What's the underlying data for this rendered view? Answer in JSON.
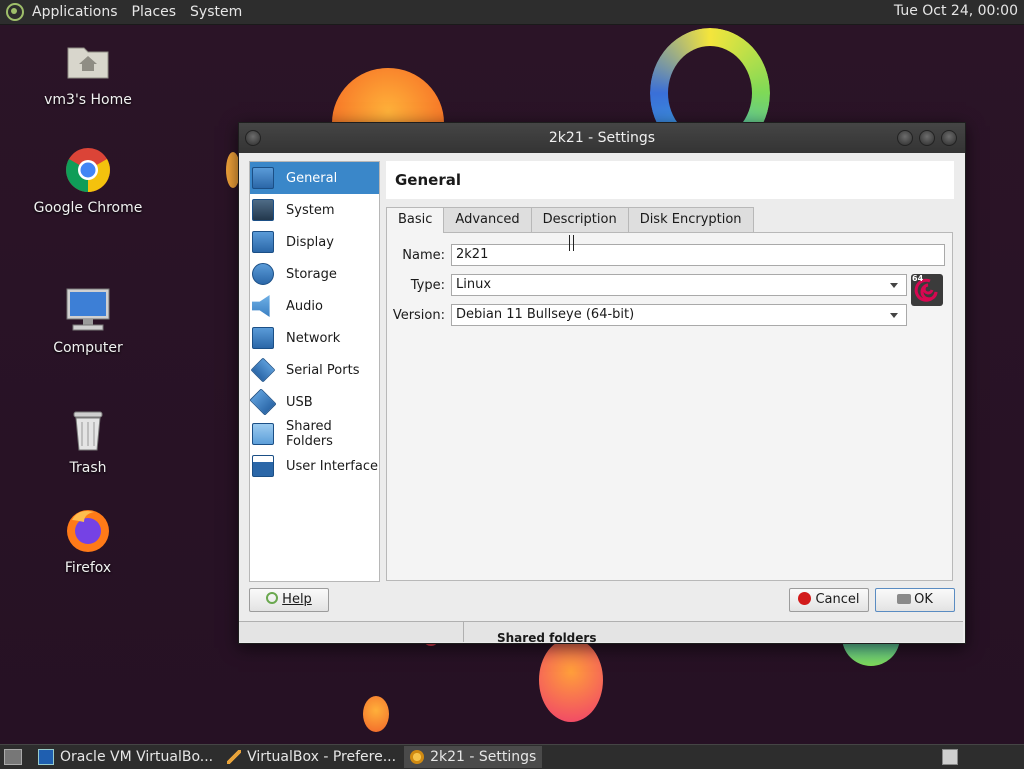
{
  "topbar": {
    "menus": [
      "Applications",
      "Places",
      "System"
    ],
    "clock": "Tue Oct 24, 00:00"
  },
  "desktop": {
    "icons": [
      {
        "label": "vm3's Home",
        "icon": "home-folder-icon"
      },
      {
        "label": "Google Chrome",
        "icon": "chrome-icon"
      },
      {
        "label": "Computer",
        "icon": "computer-icon"
      },
      {
        "label": "Trash",
        "icon": "trash-icon"
      },
      {
        "label": "Firefox",
        "icon": "firefox-icon"
      }
    ]
  },
  "window": {
    "title": "2k21 - Settings",
    "sidebar": [
      {
        "label": "General",
        "icon": "general-icon",
        "active": true
      },
      {
        "label": "System",
        "icon": "system-icon"
      },
      {
        "label": "Display",
        "icon": "display-icon"
      },
      {
        "label": "Storage",
        "icon": "storage-icon"
      },
      {
        "label": "Audio",
        "icon": "audio-icon"
      },
      {
        "label": "Network",
        "icon": "network-icon"
      },
      {
        "label": "Serial Ports",
        "icon": "serial-ports-icon"
      },
      {
        "label": "USB",
        "icon": "usb-icon"
      },
      {
        "label": "Shared Folders",
        "icon": "shared-folders-icon"
      },
      {
        "label": "User Interface",
        "icon": "user-interface-icon"
      }
    ],
    "section_title": "General",
    "tabs": [
      {
        "label": "Basic",
        "active": true
      },
      {
        "label": "Advanced"
      },
      {
        "label": "Description"
      },
      {
        "label": "Disk Encryption"
      }
    ],
    "form": {
      "name_label": "Name:",
      "name_value": "2k21",
      "type_label": "Type:",
      "type_value": "Linux",
      "version_label": "Version:",
      "version_value": "Debian 11 Bullseye (64-bit)",
      "os_icon": "debian-64-icon",
      "os_badge": "64"
    },
    "buttons": {
      "help": "Help",
      "cancel": "Cancel",
      "ok": "OK"
    },
    "behind_text": "Shared folders"
  },
  "taskbar": {
    "tasks": [
      {
        "label": "Oracle VM VirtualBo...",
        "icon": "virtualbox-icon"
      },
      {
        "label": "VirtualBox - Prefere...",
        "icon": "preferences-icon"
      },
      {
        "label": "2k21 - Settings",
        "icon": "settings-icon",
        "active": true
      }
    ]
  },
  "colors": {
    "selection": "#3a87c9",
    "panel": "#2d2d2d",
    "wallpaper": "#2a1326"
  }
}
